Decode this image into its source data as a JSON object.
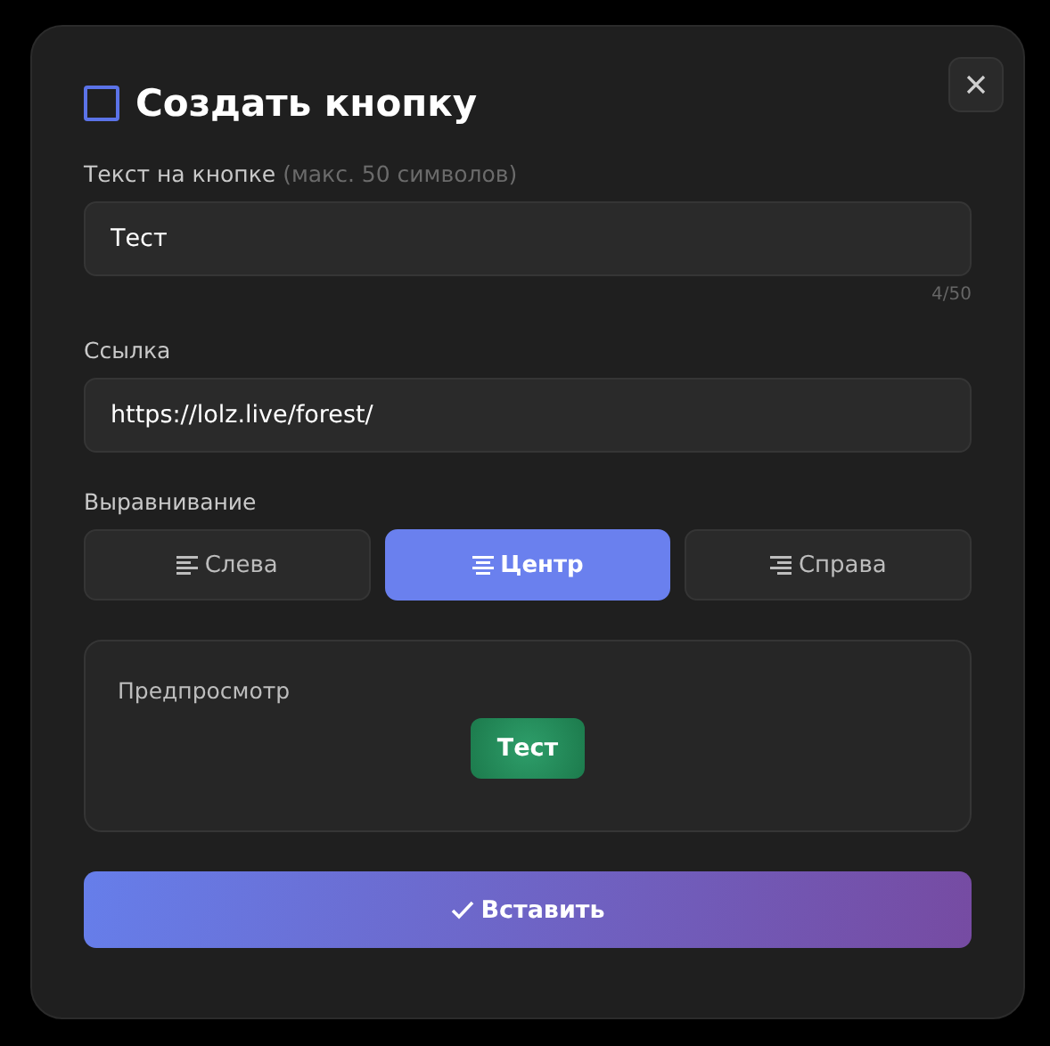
{
  "dialog": {
    "title": "Создать кнопку"
  },
  "text_field": {
    "label": "Текст на кнопке",
    "hint": "(макс. 50 символов)",
    "value": "Тест",
    "counter": "4/50"
  },
  "link_field": {
    "label": "Ссылка",
    "value": "https://lolz.live/forest/"
  },
  "alignment": {
    "label": "Выравнивание",
    "options": [
      {
        "kind": "left",
        "label": "Слева",
        "selected": false
      },
      {
        "kind": "center",
        "label": "Центр",
        "selected": true
      },
      {
        "kind": "right",
        "label": "Справа",
        "selected": false
      }
    ]
  },
  "preview": {
    "label": "Предпросмотр",
    "button_label": "Тест"
  },
  "insert_button": {
    "label": "Вставить"
  }
}
